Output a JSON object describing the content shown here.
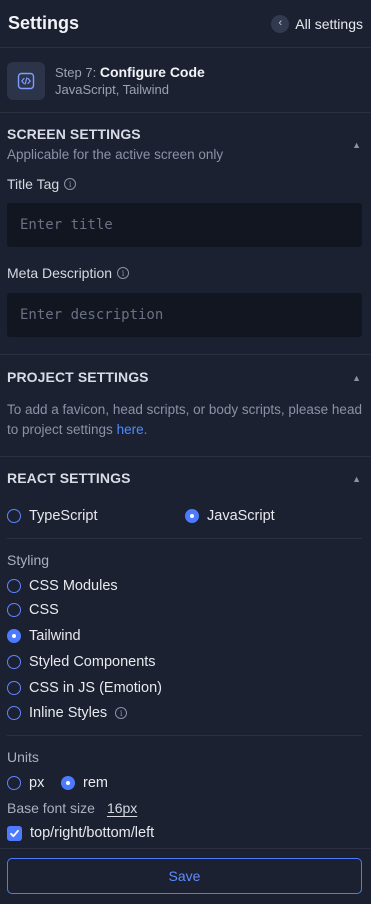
{
  "header": {
    "title": "Settings",
    "back_label": "All settings"
  },
  "step": {
    "prefix": "Step 7:",
    "name": "Configure Code",
    "subtitle": "JavaScript, Tailwind"
  },
  "screen_settings": {
    "title": "SCREEN SETTINGS",
    "subtitle": "Applicable for the active screen only",
    "title_tag_label": "Title Tag",
    "title_tag_placeholder": "Enter title",
    "meta_label": "Meta Description",
    "meta_placeholder": "Enter description"
  },
  "project_settings": {
    "title": "PROJECT SETTINGS",
    "text": "To add a favicon, head scripts, or body scripts, please head to project settings ",
    "link": "here."
  },
  "react_settings": {
    "title": "REACT SETTINGS",
    "languages": [
      {
        "label": "TypeScript",
        "selected": false
      },
      {
        "label": "JavaScript",
        "selected": true
      }
    ],
    "styling_label": "Styling",
    "styling_options": [
      {
        "label": "CSS Modules",
        "selected": false
      },
      {
        "label": "CSS",
        "selected": false
      },
      {
        "label": "Tailwind",
        "selected": true
      },
      {
        "label": "Styled Components",
        "selected": false
      },
      {
        "label": "CSS in JS (Emotion)",
        "selected": false
      },
      {
        "label": "Inline Styles",
        "selected": false
      }
    ],
    "units_label": "Units",
    "units": [
      {
        "label": "px",
        "selected": false
      },
      {
        "label": "rem",
        "selected": true
      }
    ],
    "base_font_label": "Base font size",
    "base_font_value": "16px",
    "trbl_label": "top/right/bottom/left",
    "trbl_checked": true
  },
  "save_label": "Save",
  "colors": {
    "background": "#1c2131",
    "accent": "#4d7bff",
    "input_bg": "#121620"
  }
}
